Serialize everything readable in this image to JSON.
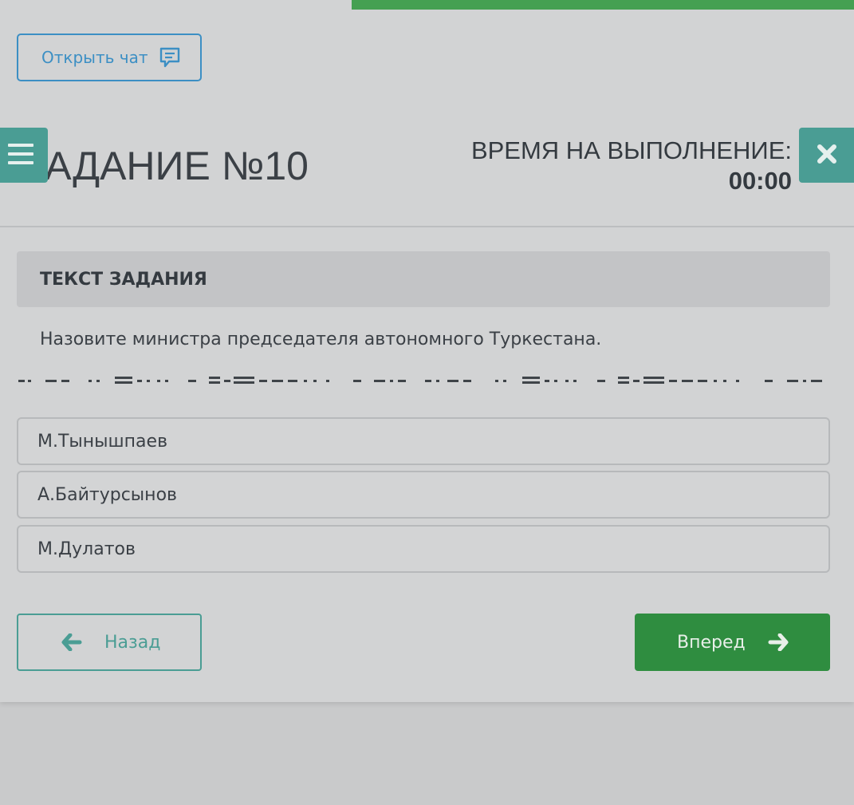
{
  "chat_button": {
    "label": "Открыть чат",
    "icon": "chat-icon"
  },
  "menu_button": {
    "icon": "hamburger-menu-icon"
  },
  "close_button": {
    "icon": "close-icon"
  },
  "progress": {
    "fraction": 0.59,
    "color": "#45a052"
  },
  "task": {
    "title": "ЗАДАНИЕ №10",
    "section_header": "ТЕКСТ ЗАДАНИЯ",
    "question": "Назовите министра председателя автономного Туркестана."
  },
  "timer": {
    "label": "ВРЕМЯ НА ВЫПОЛНЕНИЕ:",
    "value": "00:00"
  },
  "options": [
    {
      "label": "М.Тынышпаев"
    },
    {
      "label": "А.Байтурсынов"
    },
    {
      "label": "М.Дулатов"
    }
  ],
  "navigation": {
    "back_label": "Назад",
    "back_icon": "arrow-left-icon",
    "next_label": "Вперед",
    "next_icon": "arrow-right-icon"
  },
  "colors": {
    "accent_teal": "#4a9d94",
    "accent_blue": "#3c8fc4",
    "primary_green": "#2f8d40"
  }
}
